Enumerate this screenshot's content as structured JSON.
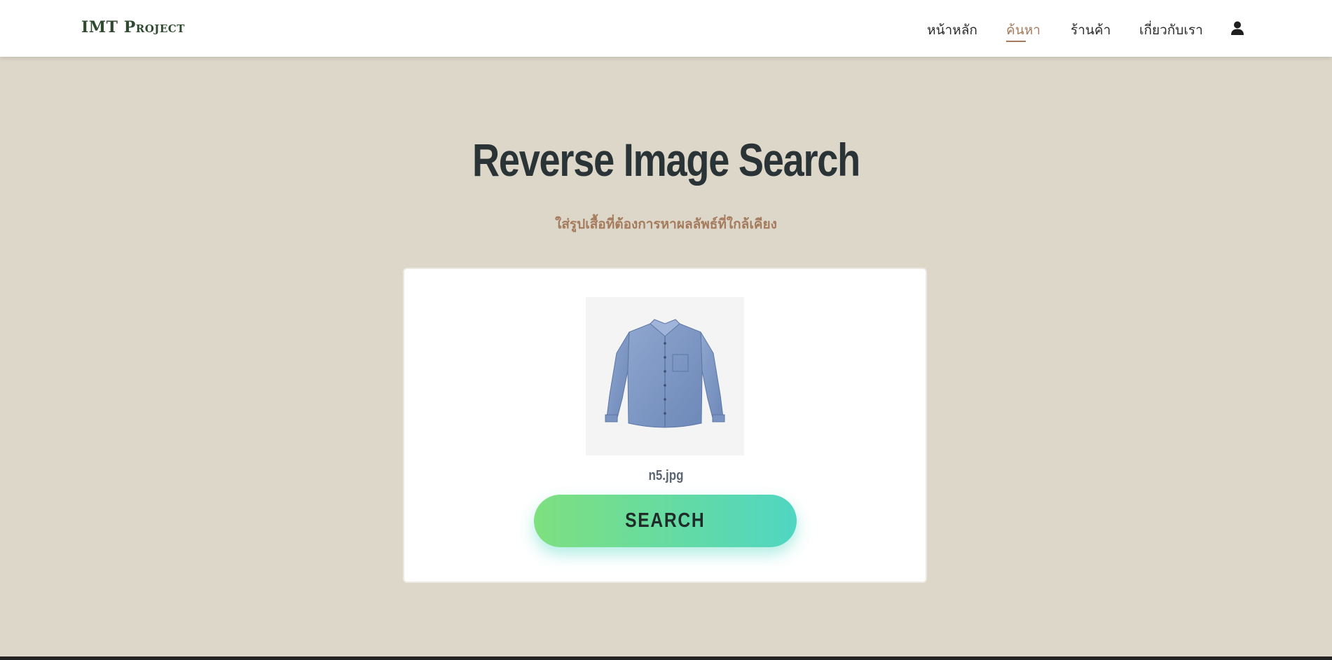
{
  "header": {
    "brand": {
      "part1": "IMT ",
      "part2": "Project"
    },
    "nav": [
      {
        "label": "หน้าหลัก",
        "active": false
      },
      {
        "label": "ค้นหา",
        "active": true
      },
      {
        "label": "ร้านค้า",
        "active": false
      },
      {
        "label": "เกี่ยวกับเรา",
        "active": false
      }
    ],
    "user_icon": "user-icon"
  },
  "main": {
    "title": "Reverse Image Search",
    "subtitle": "ใส่รูปเสื้อที่ต้องการหาผลลัพธ์ที่ใกล้เคียง",
    "upload": {
      "preview_icon": "blue-shirt-image",
      "filename": "n5.jpg"
    },
    "search_button": "SEARCH"
  },
  "colors": {
    "background": "#ddd7c9",
    "accent": "#a47b5d",
    "brand": "#2f4a2e",
    "title": "#2a3336",
    "button_gradient_start": "#7ee07f",
    "button_gradient_end": "#4fd6c2"
  }
}
